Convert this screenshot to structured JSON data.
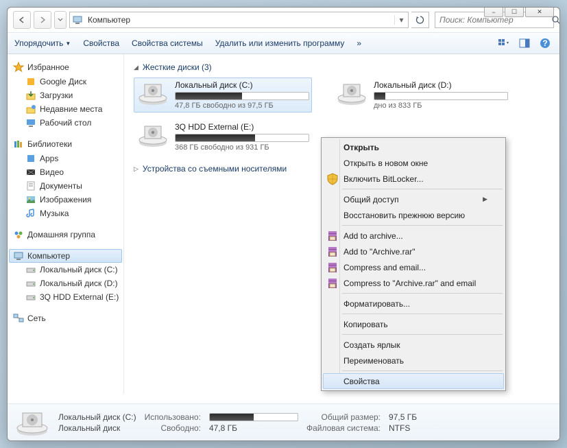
{
  "window": {
    "min": "−",
    "max": "☐",
    "close": "✕"
  },
  "address": {
    "location": "Компьютер",
    "search_placeholder": "Поиск: Компьютер"
  },
  "toolbar": {
    "organize": "Упорядочить",
    "properties": "Свойства",
    "sys_properties": "Свойства системы",
    "uninstall": "Удалить или изменить программу",
    "more": "»"
  },
  "sidebar": {
    "favorites": {
      "label": "Избранное",
      "items": [
        "Google Диск",
        "Загрузки",
        "Недавние места",
        "Рабочий стол"
      ]
    },
    "libraries": {
      "label": "Библиотеки",
      "items": [
        "Apps",
        "Видео",
        "Документы",
        "Изображения",
        "Музыка"
      ]
    },
    "homegroup": {
      "label": "Домашняя группа"
    },
    "computer": {
      "label": "Компьютер",
      "items": [
        "Локальный диск (C:)",
        "Локальный диск (D:)",
        "3Q HDD External (E:)"
      ]
    },
    "network": {
      "label": "Сеть"
    }
  },
  "main": {
    "hard_drives": {
      "label": "Жесткие диски (3)",
      "count": 3
    },
    "removable": {
      "label": "Устройства со съемными носителями"
    },
    "drives": [
      {
        "name": "Локальный диск (C:)",
        "sub": "47,8 ГБ свободно из 97,5 ГБ",
        "fill": 50,
        "selected": true
      },
      {
        "name": "Локальный диск (D:)",
        "sub": "дно из 833 ГБ",
        "fill": 8,
        "selected": false
      },
      {
        "name": "3Q HDD External (E:)",
        "sub": "368 ГБ свободно из 931 ГБ",
        "fill": 60,
        "selected": false
      }
    ]
  },
  "context": [
    {
      "t": "item",
      "label": "Открыть",
      "bold": true
    },
    {
      "t": "item",
      "label": "Открыть в новом окне"
    },
    {
      "t": "item",
      "label": "Включить BitLocker...",
      "icon": "shield"
    },
    {
      "t": "sep"
    },
    {
      "t": "item",
      "label": "Общий доступ",
      "arrow": true
    },
    {
      "t": "item",
      "label": "Восстановить прежнюю версию"
    },
    {
      "t": "sep"
    },
    {
      "t": "item",
      "label": "Add to archive...",
      "icon": "rar"
    },
    {
      "t": "item",
      "label": "Add to \"Archive.rar\"",
      "icon": "rar"
    },
    {
      "t": "item",
      "label": "Compress and email...",
      "icon": "rar"
    },
    {
      "t": "item",
      "label": "Compress to \"Archive.rar\" and email",
      "icon": "rar"
    },
    {
      "t": "sep"
    },
    {
      "t": "item",
      "label": "Форматировать..."
    },
    {
      "t": "sep"
    },
    {
      "t": "item",
      "label": "Копировать"
    },
    {
      "t": "sep"
    },
    {
      "t": "item",
      "label": "Создать ярлык"
    },
    {
      "t": "item",
      "label": "Переименовать"
    },
    {
      "t": "sep"
    },
    {
      "t": "item",
      "label": "Свойства",
      "hl": true
    }
  ],
  "details": {
    "name": "Локальный диск (C:)",
    "used_label": "Использовано:",
    "total_label": "Общий размер:",
    "total": "97,5 ГБ",
    "disk_label": "Локальный диск",
    "free_label": "Свободно:",
    "free": "47,8 ГБ",
    "fs_label": "Файловая система:",
    "fs": "NTFS",
    "fill": 50
  }
}
